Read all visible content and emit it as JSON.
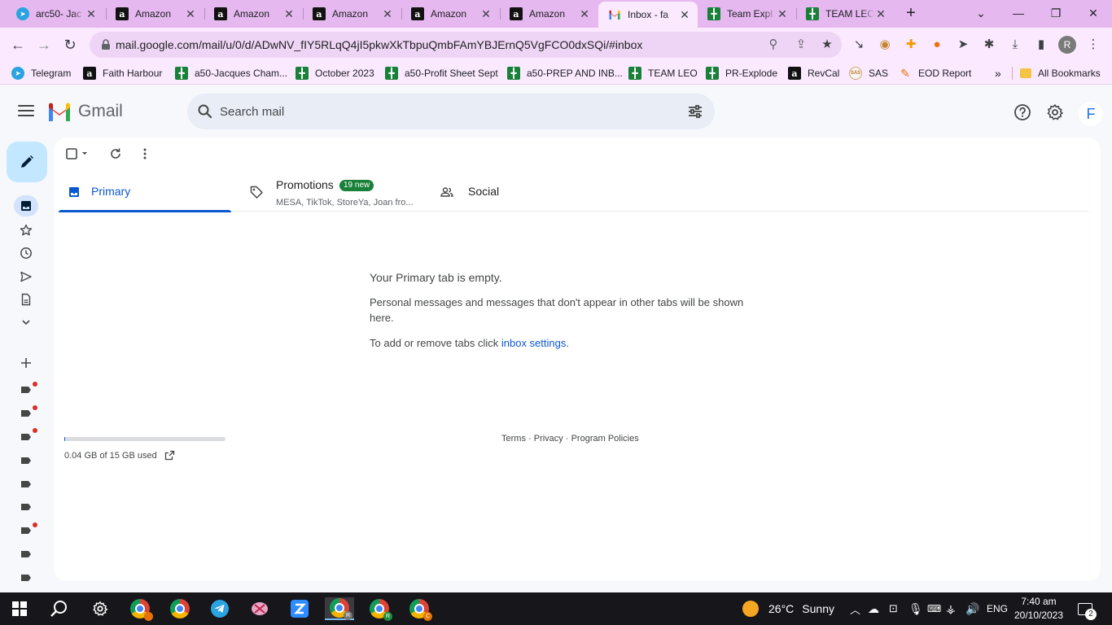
{
  "browser": {
    "tabs": [
      {
        "title": "arc50- Jac",
        "icon": "telegram-icon"
      },
      {
        "title": "Amazon",
        "icon": "amazon-icon"
      },
      {
        "title": "Amazon",
        "icon": "amazon-icon"
      },
      {
        "title": "Amazon",
        "icon": "amazon-icon"
      },
      {
        "title": "Amazon",
        "icon": "amazon-icon"
      },
      {
        "title": "Amazon",
        "icon": "amazon-icon"
      },
      {
        "title": "Inbox - fa",
        "icon": "gmail-icon",
        "active": true
      },
      {
        "title": "Team Expl",
        "icon": "sheets-icon"
      },
      {
        "title": "TEAM LEO",
        "icon": "sheets-icon"
      }
    ],
    "url": "mail.google.com/mail/u/0/d/ADwNV_fIY5RLqQ4jI5pkwXkTbpuQmbFAmYBJErnQ5VgFCO0dxSQi/#inbox",
    "profile_initial": "R",
    "bookmarks": [
      {
        "label": "Telegram",
        "icon": "telegram-icon"
      },
      {
        "label": "Faith Harbour",
        "icon": "amazon-icon"
      },
      {
        "label": "a50-Jacques Cham...",
        "icon": "sheets-icon"
      },
      {
        "label": "October 2023",
        "icon": "sheets-icon"
      },
      {
        "label": "a50-Profit Sheet Sept",
        "icon": "sheets-icon"
      },
      {
        "label": "a50-PREP AND INB...",
        "icon": "sheets-icon"
      },
      {
        "label": "TEAM LEO",
        "icon": "sheets-icon"
      },
      {
        "label": "PR-Explode",
        "icon": "sheets-icon"
      },
      {
        "label": "RevCal",
        "icon": "amazon-icon"
      },
      {
        "label": "SAS",
        "icon": "sas-icon"
      },
      {
        "label": "EOD Report",
        "icon": "eod-icon"
      }
    ],
    "bookmarks_overflow": "»",
    "all_bookmarks": "All Bookmarks"
  },
  "gmail": {
    "logo_text": "Gmail",
    "search_placeholder": "Search mail",
    "avatar_initial": "F",
    "tabs": [
      {
        "label": "Primary",
        "icon": "inbox-icon"
      },
      {
        "label": "Promotions",
        "icon": "tag-icon",
        "badge": "19 new",
        "subtitle": "MESA, TikTok, StoreYa, Joan fro..."
      },
      {
        "label": "Social",
        "icon": "people-icon"
      }
    ],
    "empty": {
      "title": "Your Primary tab is empty.",
      "line1": "Personal messages and messages that don't appear in other tabs will be shown here.",
      "line2_prefix": "To add or remove tabs click ",
      "line2_link": "inbox settings",
      "line2_suffix": "."
    },
    "storage": {
      "text": "0.04 GB of 15 GB used",
      "used_fraction": 0.003
    },
    "footer": {
      "terms": "Terms",
      "privacy": "Privacy",
      "policies": "Program Policies",
      "sep": " · "
    }
  },
  "taskbar": {
    "weather_temp": "26°C",
    "weather_desc": "Sunny",
    "language": "ENG",
    "time": "7:40 am",
    "date": "20/10/2023",
    "notifications": "2"
  },
  "colors": {
    "gmail_blue": "#0b57d0",
    "promo_green": "#188038",
    "tab_strip": "#e6b8f0"
  }
}
